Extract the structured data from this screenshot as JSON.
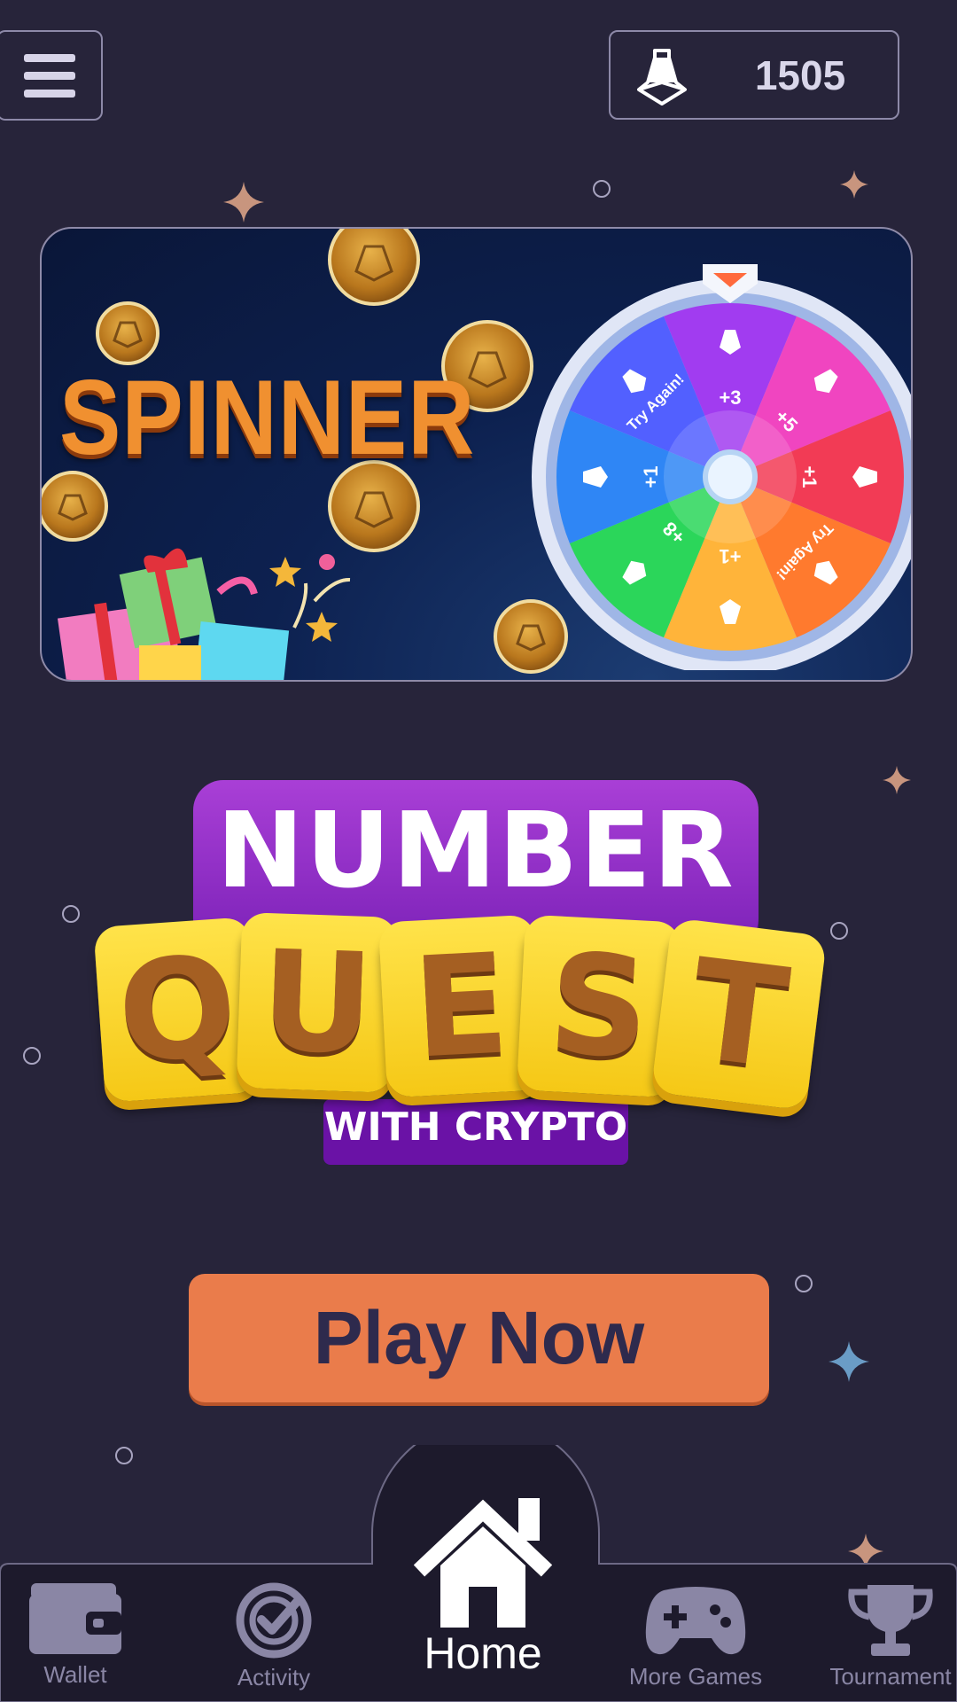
{
  "header": {
    "menu_icon": "hamburger-menu-icon",
    "balance": {
      "icon": "avax-token-icon",
      "value": "1505"
    }
  },
  "banner": {
    "title": "SPINNER",
    "wheel": {
      "segments": [
        {
          "label": "+3",
          "color": "#a13cf0"
        },
        {
          "label": "+5",
          "color": "#f045c0"
        },
        {
          "label": "+1",
          "color": "#f23b55"
        },
        {
          "label": "Try Again!",
          "color": "#ff7a2e"
        },
        {
          "label": "+1",
          "color": "#ffb43a"
        },
        {
          "label": "+8",
          "color": "#2bd65a"
        },
        {
          "label": "+1",
          "color": "#2f86f5"
        },
        {
          "label": "Try Again!",
          "color": "#5260ff"
        }
      ]
    }
  },
  "logo": {
    "line1": "NUMBER",
    "tiles": [
      "Q",
      "U",
      "E",
      "S",
      "T"
    ],
    "line3": "WITH CRYPTO"
  },
  "play_button": {
    "label": "Play Now"
  },
  "nav": {
    "items": [
      {
        "label": "Wallet",
        "icon": "wallet-icon"
      },
      {
        "label": "Activity",
        "icon": "activity-check-icon"
      },
      {
        "label": "Home",
        "icon": "home-icon",
        "active": true
      },
      {
        "label": "More Games",
        "icon": "gamepad-icon"
      },
      {
        "label": "Tournament",
        "icon": "trophy-icon"
      }
    ]
  },
  "colors": {
    "background": "#27243a",
    "accent": "#ea7c4b",
    "nav_background": "#1d1a2c"
  }
}
